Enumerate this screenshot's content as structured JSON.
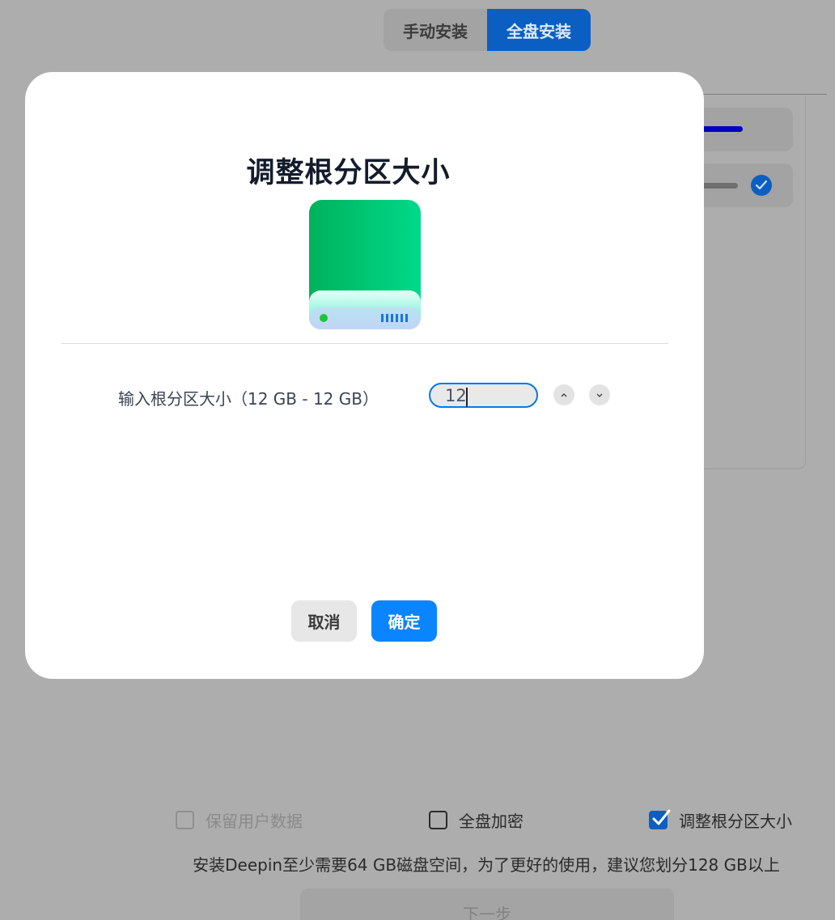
{
  "header": {
    "tabs": [
      {
        "label": "手动安装",
        "active": false
      },
      {
        "label": "全盘安装",
        "active": true
      }
    ]
  },
  "dialog": {
    "title": "调整根分区大小",
    "icon": "green-disk-icon",
    "size_label": "输入根分区大小（12 GB - 12 GB）",
    "size_value": "12",
    "cancel_label": "取消",
    "ok_label": "确定"
  },
  "options": {
    "keep_user_data": {
      "label": "保留用户数据",
      "checked": false,
      "disabled": true
    },
    "full_disk_encrypt": {
      "label": "全盘加密",
      "checked": false,
      "disabled": false
    },
    "resize_root": {
      "label": "调整根分区大小",
      "checked": true,
      "disabled": false
    }
  },
  "hint_text": "安装Deepin至少需要64 GB磁盘空间，为了更好的使用，建议您划分128 GB以上",
  "next_label": "下一步",
  "colors": {
    "accent": "#0a84ff",
    "active_tab": "#0b5fc2",
    "disk_green": "#00c36a"
  }
}
